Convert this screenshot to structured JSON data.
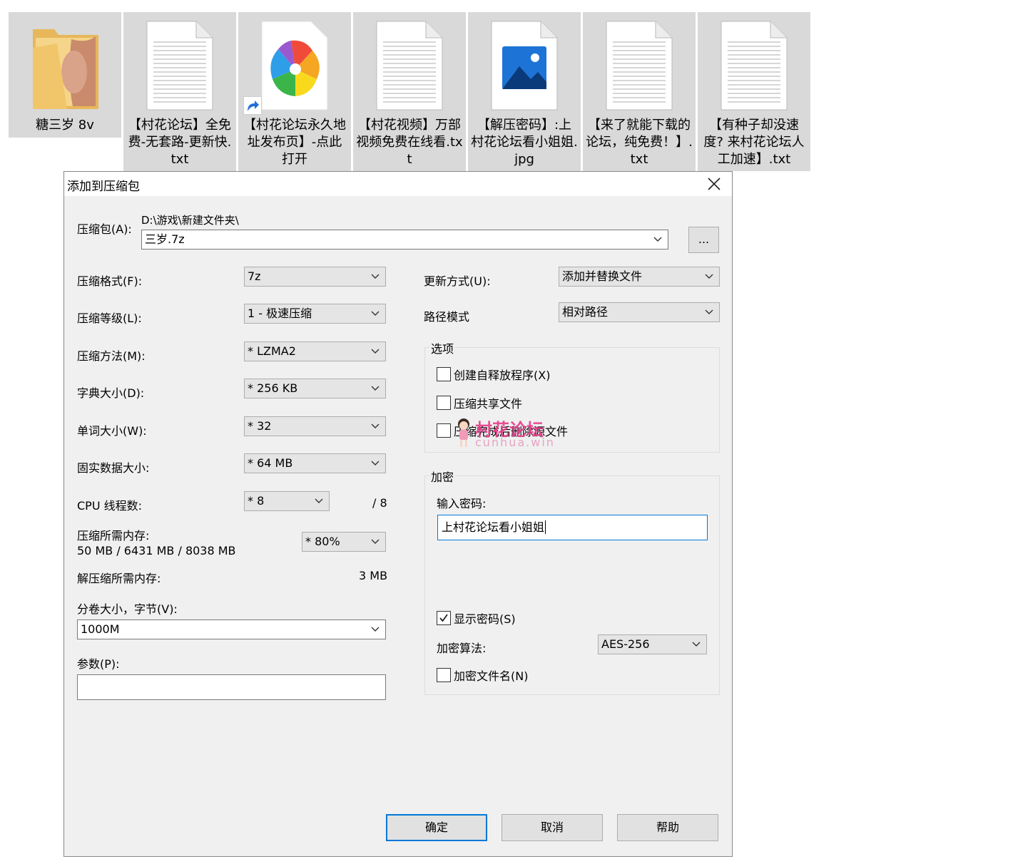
{
  "desktop": {
    "files": [
      {
        "name": "糖三岁 8v",
        "type": "folder"
      },
      {
        "name": "【村花论坛】全免费-无套路-更新快.txt",
        "type": "txt"
      },
      {
        "name": "【村花论坛永久地址发布页】-点此打开",
        "type": "shortcut"
      },
      {
        "name": "【村花视频】万部视频免费在线看.txt",
        "type": "txt"
      },
      {
        "name": "【解压密码】:上村花论坛看小姐姐.jpg",
        "type": "image"
      },
      {
        "name": "【来了就能下载的论坛，纯免费！】.txt",
        "type": "txt"
      },
      {
        "name": "【有种子却没速度? 来村花论坛人工加速】.txt",
        "type": "txt"
      }
    ]
  },
  "dialog": {
    "title": "添加到压缩包",
    "archive": {
      "label": "压缩包(A):",
      "path": "D:\\游戏\\新建文件夹\\",
      "name": "三岁.7z",
      "browse_label": "..."
    },
    "left": {
      "format": {
        "label": "压缩格式(F):",
        "value": "7z"
      },
      "level": {
        "label": "压缩等级(L):",
        "value": "1 - 极速压缩"
      },
      "method": {
        "label": "压缩方法(M):",
        "value": "*  LZMA2"
      },
      "dict": {
        "label": "字典大小(D):",
        "value": "*  256 KB"
      },
      "word": {
        "label": "单词大小(W):",
        "value": "*  32"
      },
      "solid": {
        "label": "固实数据大小:",
        "value": "*  64 MB"
      },
      "threads": {
        "label": "CPU 线程数:",
        "value": "*  8",
        "max": "/ 8"
      },
      "mem": {
        "label": "压缩所需内存:",
        "detail": "50 MB / 6431 MB / 8038 MB",
        "value": "* 80%"
      },
      "decomp": {
        "label": "解压缩所需内存:",
        "value": "3 MB"
      },
      "volume": {
        "label": "分卷大小，字节(V):",
        "value": "1000M"
      },
      "params": {
        "label": "参数(P):",
        "value": ""
      }
    },
    "right": {
      "update": {
        "label": "更新方式(U):",
        "value": "添加并替换文件"
      },
      "path_mode": {
        "label": "路径模式",
        "value": "相对路径"
      },
      "options": {
        "title": "选项",
        "items": [
          {
            "label": "创建自释放程序(X)",
            "checked": false
          },
          {
            "label": "压缩共享文件",
            "checked": false
          },
          {
            "label": "压缩完成后删除源文件",
            "checked": false
          }
        ]
      },
      "encryption": {
        "title": "加密",
        "pwd_label": "输入密码:",
        "pwd_value": "上村花论坛看小姐姐",
        "show_pwd": {
          "label": "显示密码(S)",
          "checked": true
        },
        "algo_label": "加密算法:",
        "algo_value": "AES-256",
        "encrypt_names": {
          "label": "加密文件名(N)",
          "checked": false
        }
      }
    },
    "buttons": {
      "ok": "确定",
      "cancel": "取消",
      "help": "帮助"
    }
  },
  "watermark": {
    "text": "村花论坛",
    "url": "cunhua.win"
  }
}
